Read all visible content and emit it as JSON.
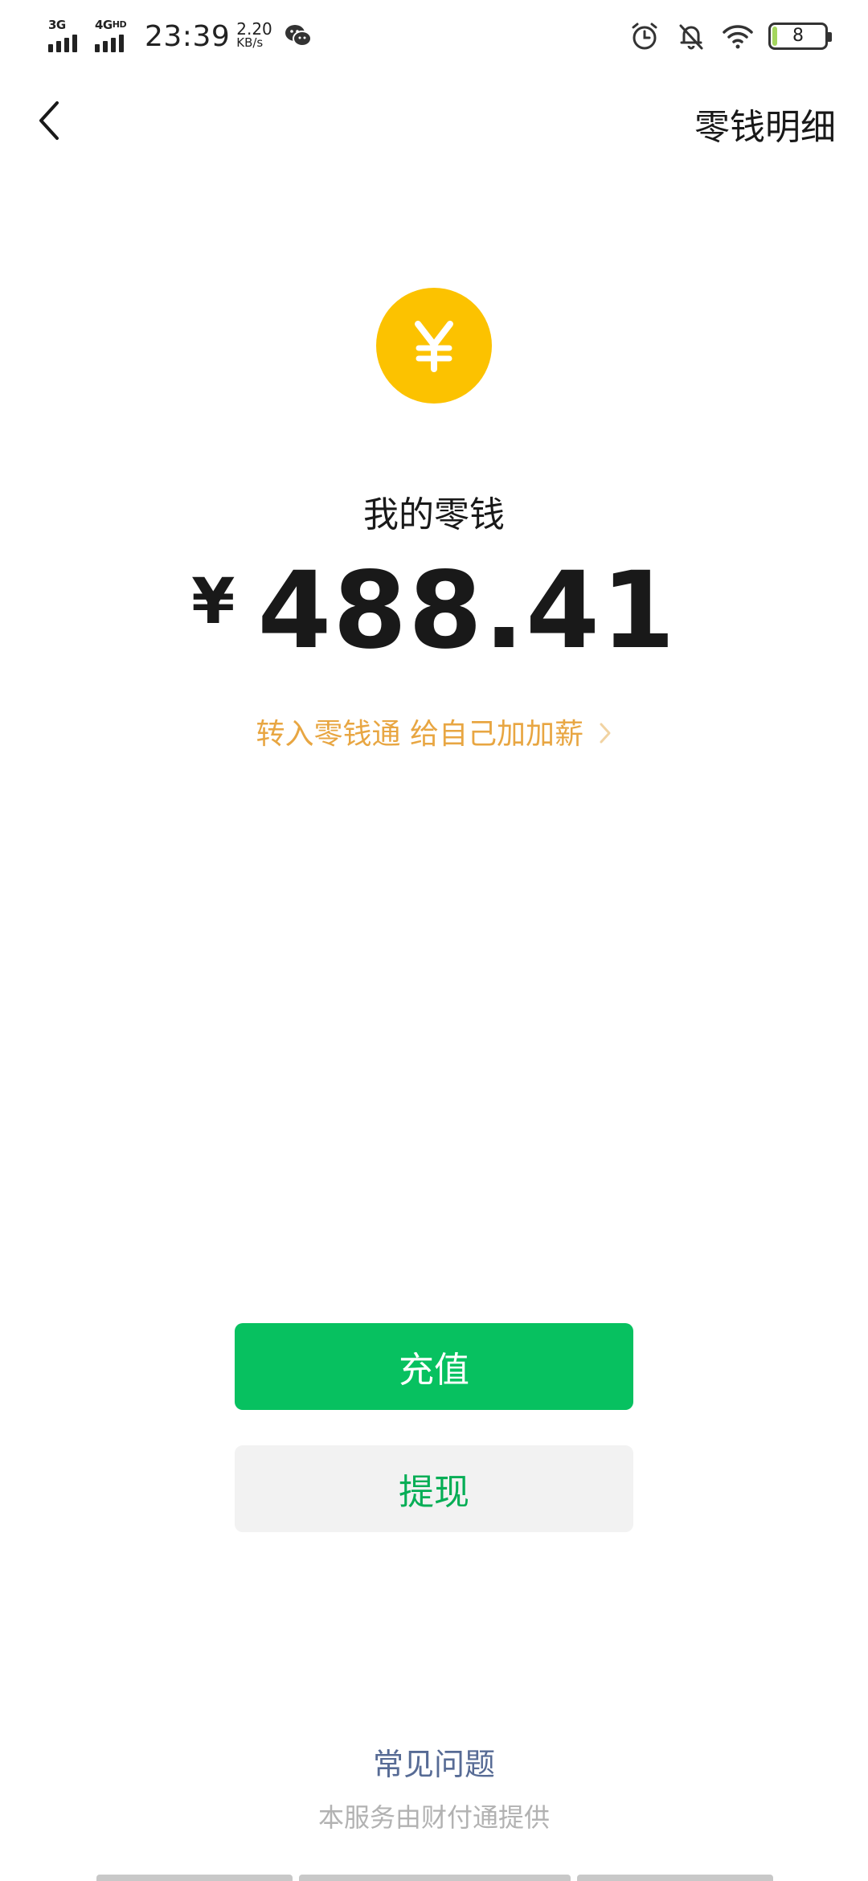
{
  "status_bar": {
    "signal_1": "3G",
    "signal_2": "4G",
    "signal_2_suffix": "HD",
    "time": "23:39",
    "speed_value": "2.20",
    "speed_unit": "KB/s",
    "battery_level": "8",
    "icons": [
      "wechat-icon",
      "alarm-icon",
      "bell-off-icon",
      "wifi-icon",
      "battery-icon"
    ]
  },
  "nav": {
    "back_icon": "chevron-left-icon",
    "right_action": "零钱明细"
  },
  "balance": {
    "coin_icon": "yuan-coin-icon",
    "label": "我的零钱",
    "currency_symbol": "¥",
    "amount": "488.41"
  },
  "promo": {
    "text": "转入零钱通 给自己加加薪",
    "icon": "chevron-right-icon"
  },
  "actions": {
    "recharge_label": "充值",
    "withdraw_label": "提现"
  },
  "footer": {
    "faq_label": "常见问题",
    "provider_note": "本服务由财付通提供"
  },
  "colors": {
    "primary_green": "#07c160",
    "green_text": "#06ae56",
    "coin_yellow": "#fcc200",
    "promo_orange": "#e8a642",
    "link_blue": "#576b95",
    "muted_gray": "#b2b2b2"
  }
}
